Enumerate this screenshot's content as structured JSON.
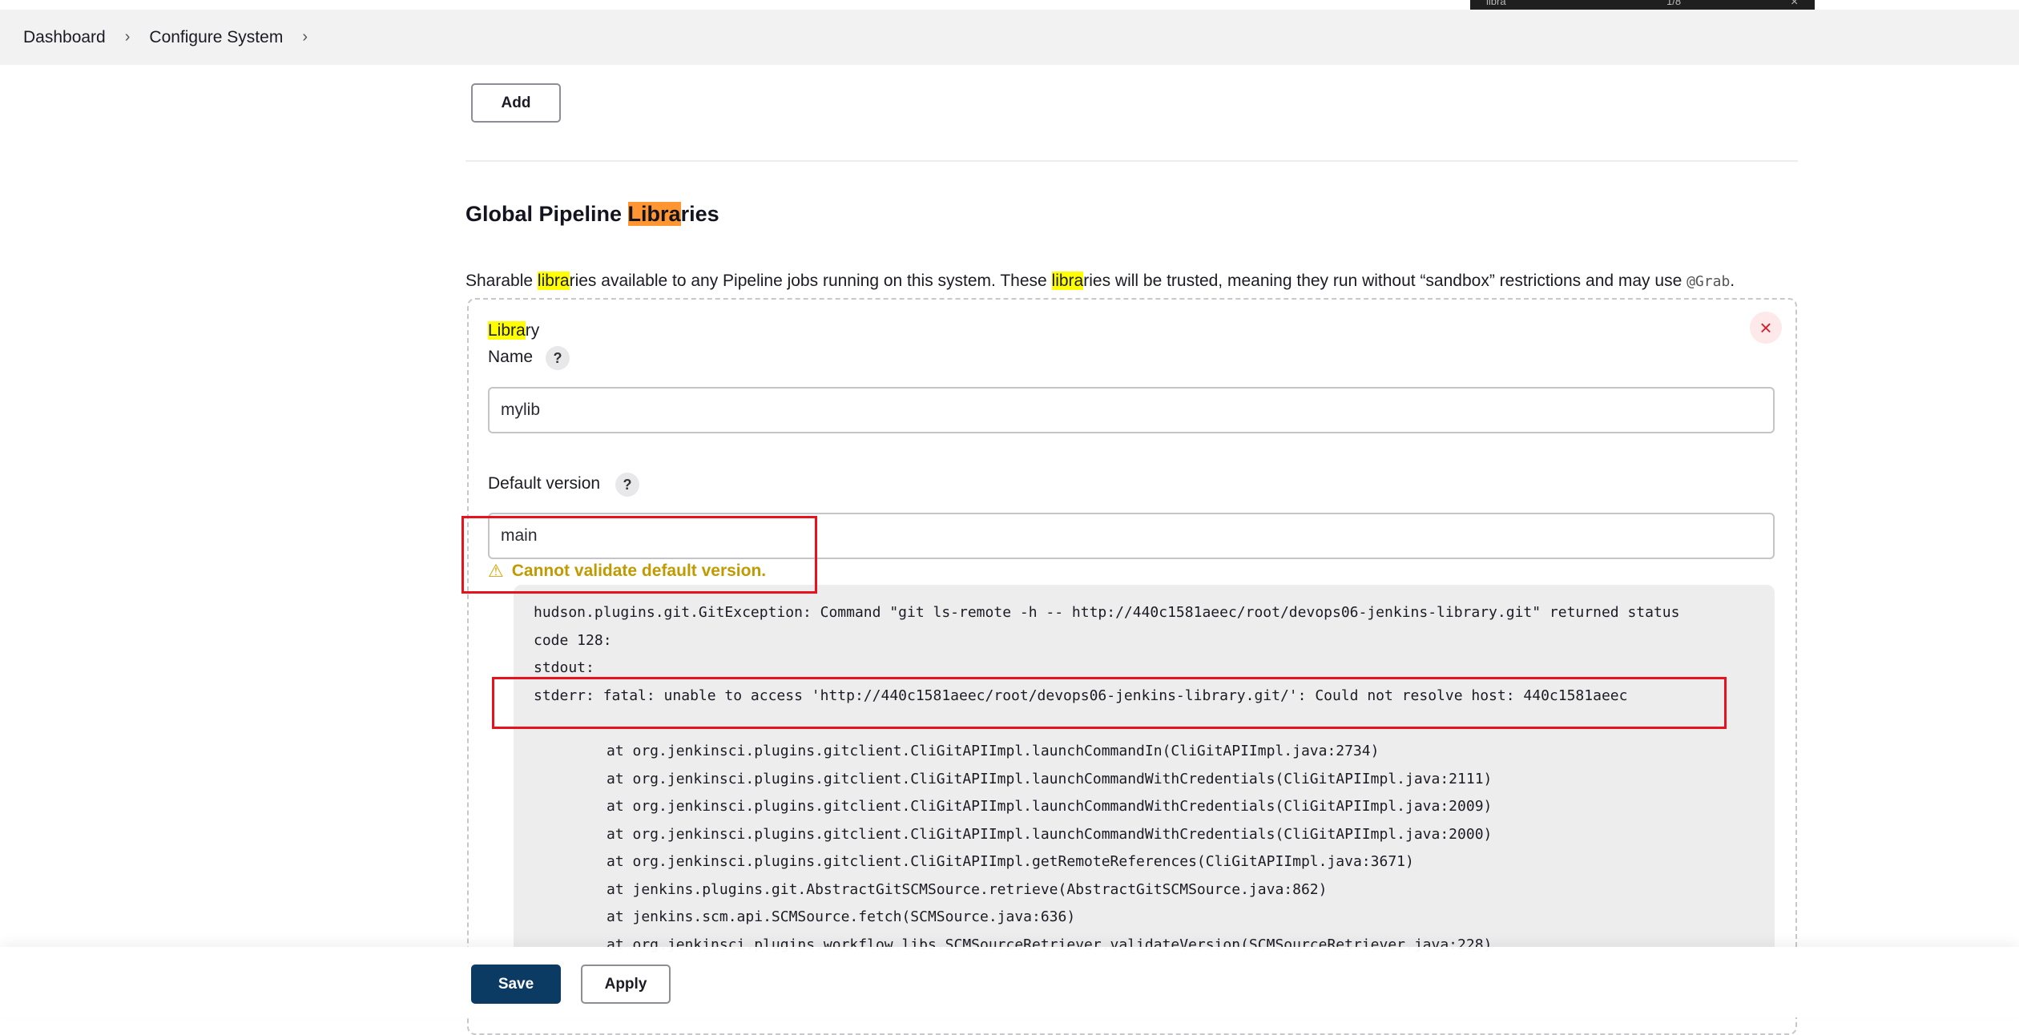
{
  "breadcrumb": {
    "items": [
      "Dashboard",
      "Configure System"
    ]
  },
  "find_bar": {
    "query": "libra",
    "count": "1/8"
  },
  "add_button": "Add",
  "section": {
    "title_parts": [
      "Global Pipeline ",
      "Libra",
      "ries"
    ],
    "description_parts": [
      "Sharable ",
      "libra",
      "ries available to any Pipeline jobs running on this system. These ",
      "libra",
      "ries will be trusted, meaning they run without “sandbox” restrictions and may use ",
      "@Grab",
      "."
    ]
  },
  "library": {
    "header_parts": [
      "Libra",
      "ry"
    ],
    "name_label": "Name",
    "name_value": "mylib",
    "default_version_label": "Default version",
    "default_version_value": "main",
    "warning": "Cannot validate default version.",
    "help_glyph": "?",
    "close_glyph": "×"
  },
  "stacktrace": {
    "lines": [
      "hudson.plugins.git.GitException: Command \"git ls-remote -h -- http://440c1581aeec/root/devops06-jenkins-library.git\" returned status",
      "code 128:",
      "stdout:",
      "stderr: fatal: unable to access 'http://440c1581aeec/root/devops06-jenkins-library.git/': Could not resolve host: 440c1581aeec"
    ],
    "at_lines": [
      "at org.jenkinsci.plugins.gitclient.CliGitAPIImpl.launchCommandIn(CliGitAPIImpl.java:2734)",
      "at org.jenkinsci.plugins.gitclient.CliGitAPIImpl.launchCommandWithCredentials(CliGitAPIImpl.java:2111)",
      "at org.jenkinsci.plugins.gitclient.CliGitAPIImpl.launchCommandWithCredentials(CliGitAPIImpl.java:2009)",
      "at org.jenkinsci.plugins.gitclient.CliGitAPIImpl.launchCommandWithCredentials(CliGitAPIImpl.java:2000)",
      "at org.jenkinsci.plugins.gitclient.CliGitAPIImpl.getRemoteReferences(CliGitAPIImpl.java:3671)",
      "at jenkins.plugins.git.AbstractGitSCMSource.retrieve(AbstractGitSCMSource.java:862)",
      "at jenkins.scm.api.SCMSource.fetch(SCMSource.java:636)",
      "at org.jenkinsci.plugins.workflow.libs.SCMSourceRetriever.validateVersion(SCMSourceRetriever.java:228)"
    ]
  },
  "footer": {
    "save": "Save",
    "apply": "Apply"
  },
  "colors": {
    "save_bg": "#0b3a63",
    "warning": "#c19a00",
    "highlight": "#ffff00",
    "current_match": "#ff9632",
    "annotation": "#e8111e"
  }
}
